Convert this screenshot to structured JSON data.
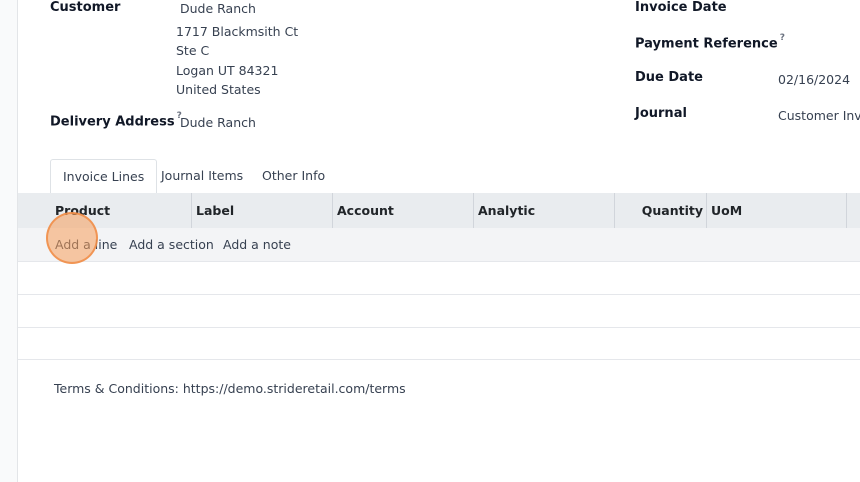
{
  "customer": {
    "label": "Customer",
    "name": "Dude Ranch",
    "address_lines": [
      "1717 Blackmsith Ct",
      "Ste C",
      "Logan UT 84321",
      "United States"
    ]
  },
  "delivery": {
    "label": "Delivery Address",
    "help": "?",
    "value": "Dude Ranch"
  },
  "right_fields": {
    "invoice_date_label": "Invoice Date",
    "invoice_date_value": "",
    "payment_reference_label": "Payment Reference",
    "payment_reference_help": "?",
    "due_date_label": "Due Date",
    "due_date_value": "02/16/2024",
    "journal_label": "Journal",
    "journal_value": "Customer Invo"
  },
  "tabs": [
    {
      "label": "Invoice Lines",
      "active": true
    },
    {
      "label": "Journal Items",
      "active": false
    },
    {
      "label": "Other Info",
      "active": false
    }
  ],
  "table": {
    "columns": [
      "Product",
      "Label",
      "Account",
      "Analytic",
      "Quantity",
      "UoM"
    ],
    "actions": [
      "Add a line",
      "Add a section",
      "Add a note"
    ]
  },
  "terms": "Terms & Conditions: https://demo.strideretail.com/terms"
}
